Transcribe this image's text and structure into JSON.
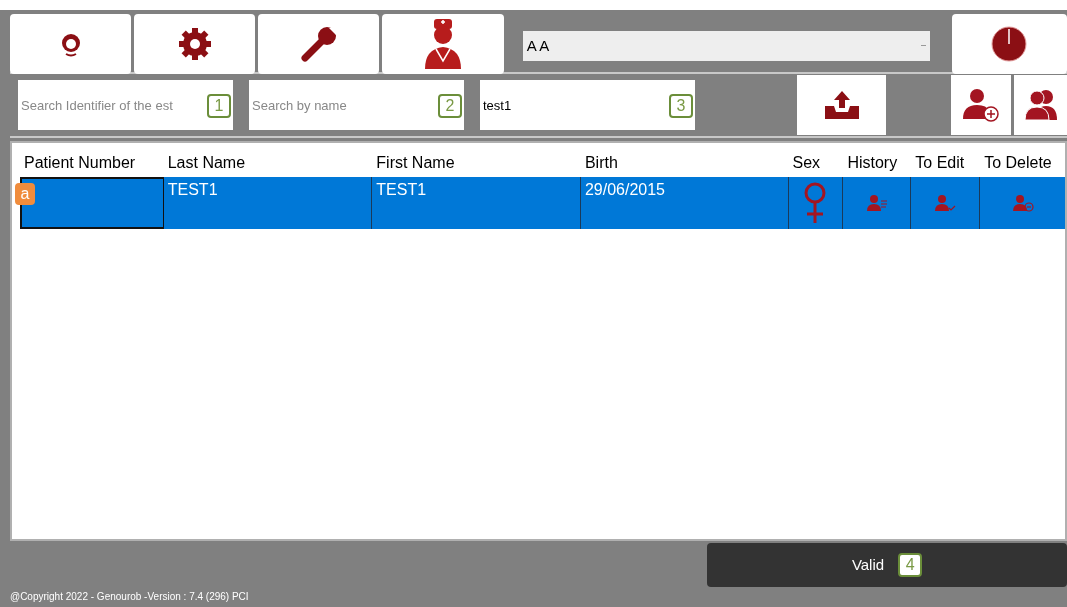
{
  "toolbar": {
    "dropdown_value": "A A"
  },
  "searches": [
    {
      "placeholder": "Search Identifier of the est",
      "callout": "1"
    },
    {
      "placeholder": "Search by name",
      "callout": "2"
    },
    {
      "value": "test1",
      "callout": "3"
    }
  ],
  "table": {
    "columns": [
      "Patient Number",
      "Last Name",
      "First Name",
      "Birth",
      "Sex",
      "History",
      "To Edit",
      "To Delete"
    ],
    "rows": [
      {
        "selected": true,
        "callout": "a",
        "last_name": "TEST1",
        "first_name": "TEST1",
        "birth": "29/06/2015",
        "sex_icon": {
          "kind": "female"
        }
      }
    ]
  },
  "valid_button": {
    "label": "Valid",
    "callout": "4"
  },
  "footer": "@Copyright 2022 - Genourob -Version : 7.4 (296) PCI"
}
